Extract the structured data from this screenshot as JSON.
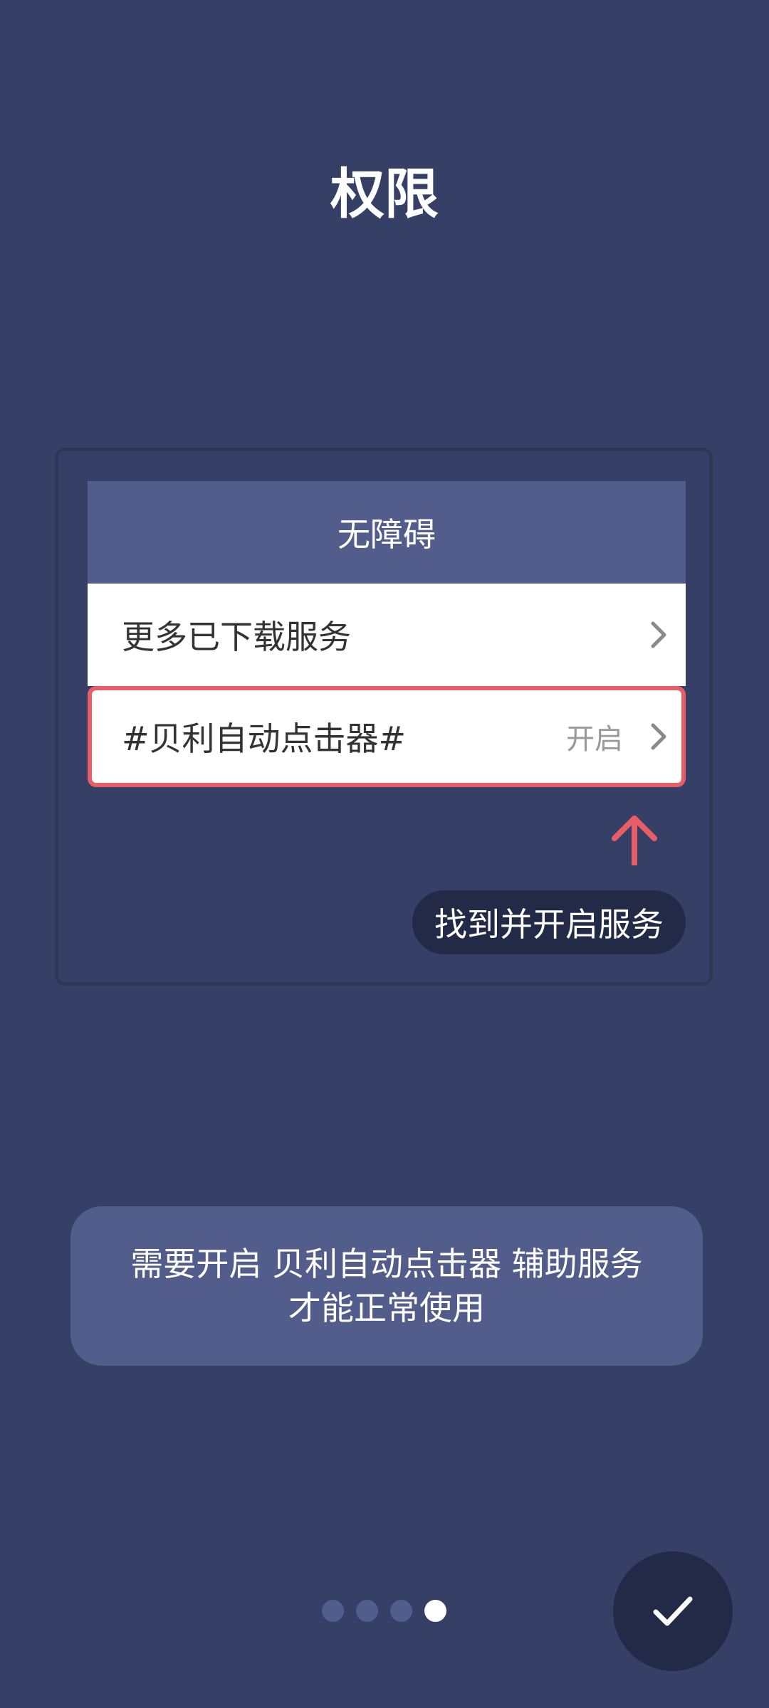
{
  "page": {
    "title": "权限"
  },
  "guide": {
    "header_title": "无障碍",
    "rows": [
      {
        "label": "更多已下载服务",
        "status": ""
      },
      {
        "label": "#贝利自动点击器#",
        "status": "开启"
      }
    ],
    "tooltip": "找到并开启服务",
    "arrow_icon": "arrow-up-icon"
  },
  "notice": {
    "line1": "需要开启 贝利自动点击器 辅助服务",
    "line2": "才能正常使用"
  },
  "pager": {
    "total": 4,
    "current": 4
  },
  "fab": {
    "icon": "check-icon"
  },
  "colors": {
    "background": "#363f66",
    "header": "#525d8c",
    "highlight": "#e85e66",
    "dark": "#232a47"
  }
}
